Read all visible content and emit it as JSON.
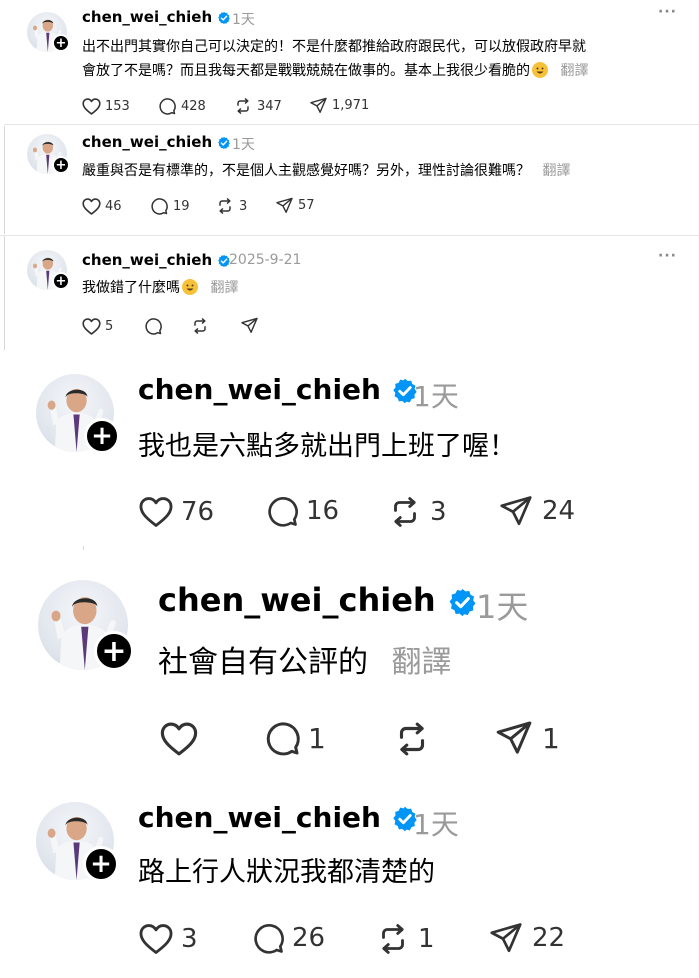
{
  "posts": [
    {
      "username": "chen_wei_chieh",
      "time": "1天",
      "lines": [
        "出不出門其實你自己可以決定的！不是什麼都推給政府跟民代，可以放假政府早就",
        "會放了不是嗎？而且我每天都是戰戰兢兢在做事的。基本上我很少看脆的"
      ],
      "translate": "翻譯",
      "more": "···",
      "likes": "153",
      "replies": "428",
      "reposts": "347",
      "shares": "1,971"
    },
    {
      "username": "chen_wei_chieh",
      "time": "1天",
      "lines": [
        "嚴重與否是有標準的，不是個人主觀感覺好嗎？另外，理性討論很難嗎？"
      ],
      "translate": "翻譯",
      "more": "···",
      "likes": "46",
      "replies": "19",
      "reposts": "3",
      "shares": "57"
    },
    {
      "username": "chen_wei_chieh",
      "time": "2025-9-21",
      "lines": [
        "我做錯了什麼嗎"
      ],
      "translate": "翻譯",
      "more": "···",
      "likes": "5"
    },
    {
      "username": "chen_wei_chieh",
      "time": "1天",
      "lines": [
        "我也是六點多就出門上班了喔！"
      ],
      "likes": "76",
      "replies": "16",
      "reposts": "3",
      "shares": "24"
    },
    {
      "username": "chen_wei_chieh",
      "time": "1天",
      "lines": [
        "社會自有公評的"
      ],
      "translate": "翻譯",
      "replies": "1",
      "shares": "1"
    },
    {
      "username": "chen_wei_chieh",
      "time": "1天",
      "lines": [
        "路上行人狀況我都清楚的"
      ],
      "likes": "3",
      "replies": "26",
      "reposts": "1",
      "shares": "22"
    }
  ],
  "colors": {
    "verified": "#0095f6",
    "muted": "#9a9a9a"
  },
  "icons": {
    "like": "heart-icon",
    "reply": "comment-icon",
    "repost": "repost-icon",
    "share": "share-icon",
    "verified": "verified-badge-icon",
    "follow": "plus-icon",
    "emoji_1": "grinning-sweat-emoji",
    "emoji_2": "rofl-emoji"
  }
}
